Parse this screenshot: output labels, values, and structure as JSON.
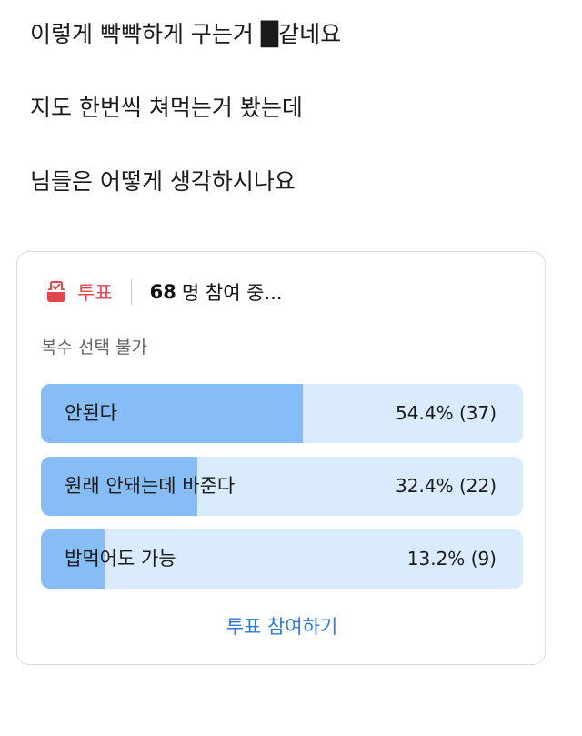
{
  "post": {
    "lines": [
      "이렇게 빡빡하게 구는거 █같네요",
      "지도 한번씩 쳐먹는거 봤는데",
      "님들은 어떻게 생각하시나요"
    ]
  },
  "poll": {
    "icon": "ballot-box-icon",
    "tag": "투표",
    "participants": "68",
    "participants_suffix": "명 참여 중...",
    "note": "복수 선택 불가",
    "accent_color": "#e0464b",
    "bar_fill_color": "#87bdf6",
    "bar_track_color": "#d9ebfd",
    "options": [
      {
        "label": "안된다",
        "percent": 54.4,
        "result": "54.4% (37)"
      },
      {
        "label": "원래 안돼는데 바준다",
        "percent": 32.4,
        "result": "32.4% (22)"
      },
      {
        "label": "밥먹어도 가능",
        "percent": 13.2,
        "result": "13.2% (9)"
      }
    ],
    "vote_button": "투표 참여하기",
    "link_color": "#2d7ad6"
  }
}
